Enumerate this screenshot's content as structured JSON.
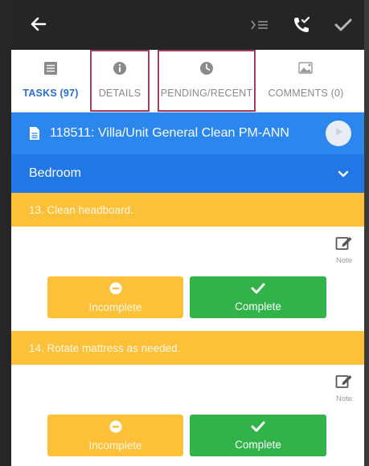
{
  "topbar": {
    "back_icon": "arrow-left-icon",
    "icons": [
      "indent-list-icon",
      "phone-check-icon",
      "checkmark-icon"
    ]
  },
  "tabs": [
    {
      "label": "TASKS (97)",
      "icon": "list-icon",
      "active": true
    },
    {
      "label": "DETAILS",
      "icon": "info-icon",
      "active": false
    },
    {
      "label": "PENDING/RECENT",
      "icon": "clock-icon",
      "active": false
    },
    {
      "label": "COMMENTS (0)",
      "icon": "image-icon",
      "active": false
    }
  ],
  "work_order": {
    "title": "118511: Villa/Unit General Clean PM-ANN"
  },
  "room": {
    "label": "Bedroom"
  },
  "tasks": [
    {
      "title": "13. Clean headboard.",
      "note_label": "Note",
      "incomplete_label": "Incomplete",
      "complete_label": "Complete"
    },
    {
      "title": "14. Rotate mattress as needed.",
      "note_label": "Note",
      "incomplete_label": "Incomplete",
      "complete_label": "Complete"
    }
  ],
  "colors": {
    "topbar": "#252525",
    "accent_blue": "#2a6fc9",
    "work_order_bar": "#2b86ee",
    "room_bar": "#2177e6",
    "task_yellow": "#fdc039",
    "complete_green": "#32b34a",
    "highlight_box": "#a0405a"
  }
}
